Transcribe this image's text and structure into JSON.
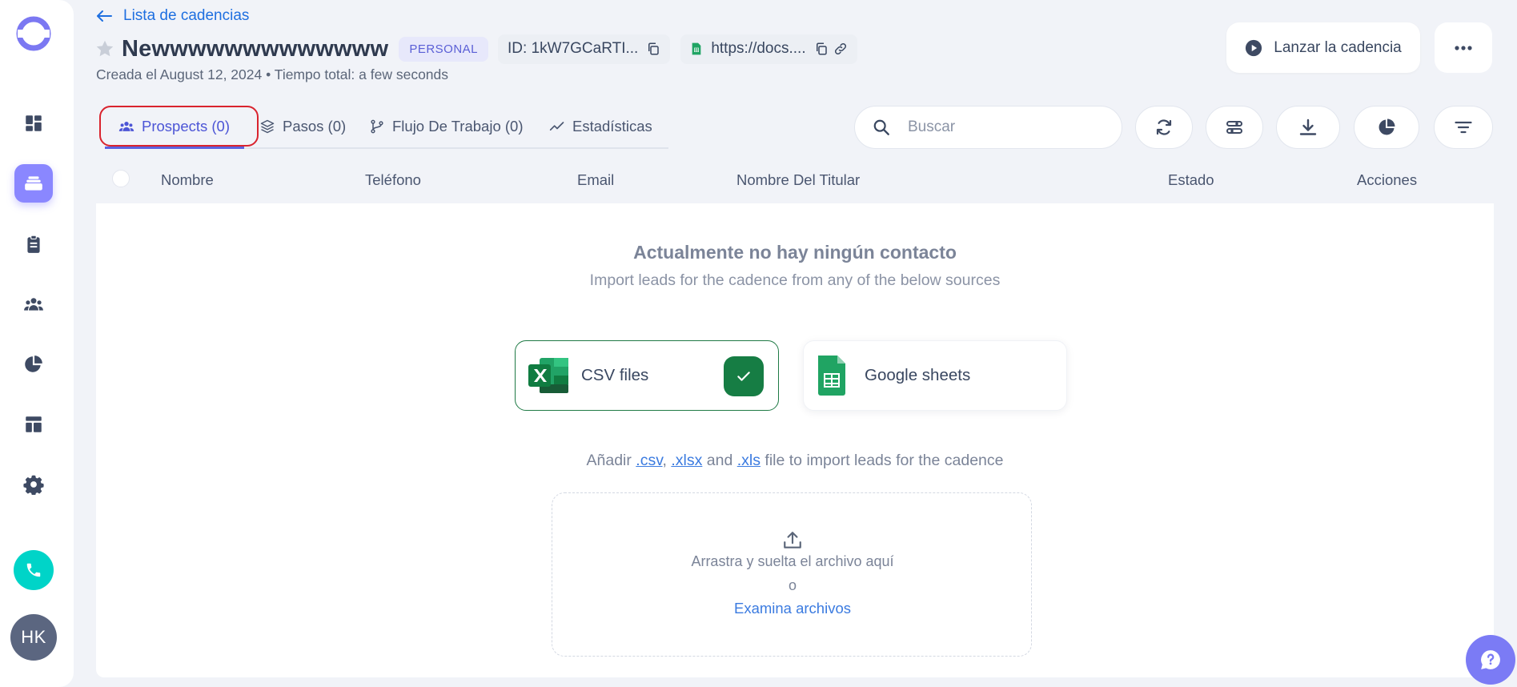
{
  "header": {
    "back_label": "Lista de cadencias",
    "title": "Newwwwwwwwwwwww",
    "badge": "PERSONAL",
    "id_chip": "ID: 1kW7GCaRTI...",
    "link_chip": "https://docs....",
    "subtitle": "Creada el August 12, 2024 • Tiempo total: a few seconds",
    "launch_label": "Lanzar la cadencia"
  },
  "tabs": [
    {
      "label": "Prospects (0)"
    },
    {
      "label": "Pasos (0)"
    },
    {
      "label": "Flujo De Trabajo (0)"
    },
    {
      "label": "Estadísticas"
    }
  ],
  "search": {
    "placeholder": "Buscar"
  },
  "table": {
    "columns": [
      "Nombre",
      "Teléfono",
      "Email",
      "Nombre Del Titular",
      "Estado",
      "Acciones"
    ]
  },
  "empty": {
    "title": "Actualmente no hay ningún contacto",
    "subtitle": "Import leads for the cadence from any of the below sources",
    "csv_label": "CSV files",
    "gs_label": "Google sheets",
    "hint_prefix": "Añadir ",
    "hint_csv": ".csv",
    "hint_sep1": ", ",
    "hint_xlsx": ".xlsx",
    "hint_and": " and ",
    "hint_xls": ".xls",
    "hint_suffix": " file to import leads for the cadence",
    "drop_label": "Arrastra y suelta el archivo aquí",
    "or_label": "o",
    "browse_label": "Examina archivos"
  },
  "user": {
    "initials": "HK"
  },
  "colors": {
    "accent": "#5b62e0",
    "call": "#00d4c8",
    "excel_green": "#167d44"
  }
}
